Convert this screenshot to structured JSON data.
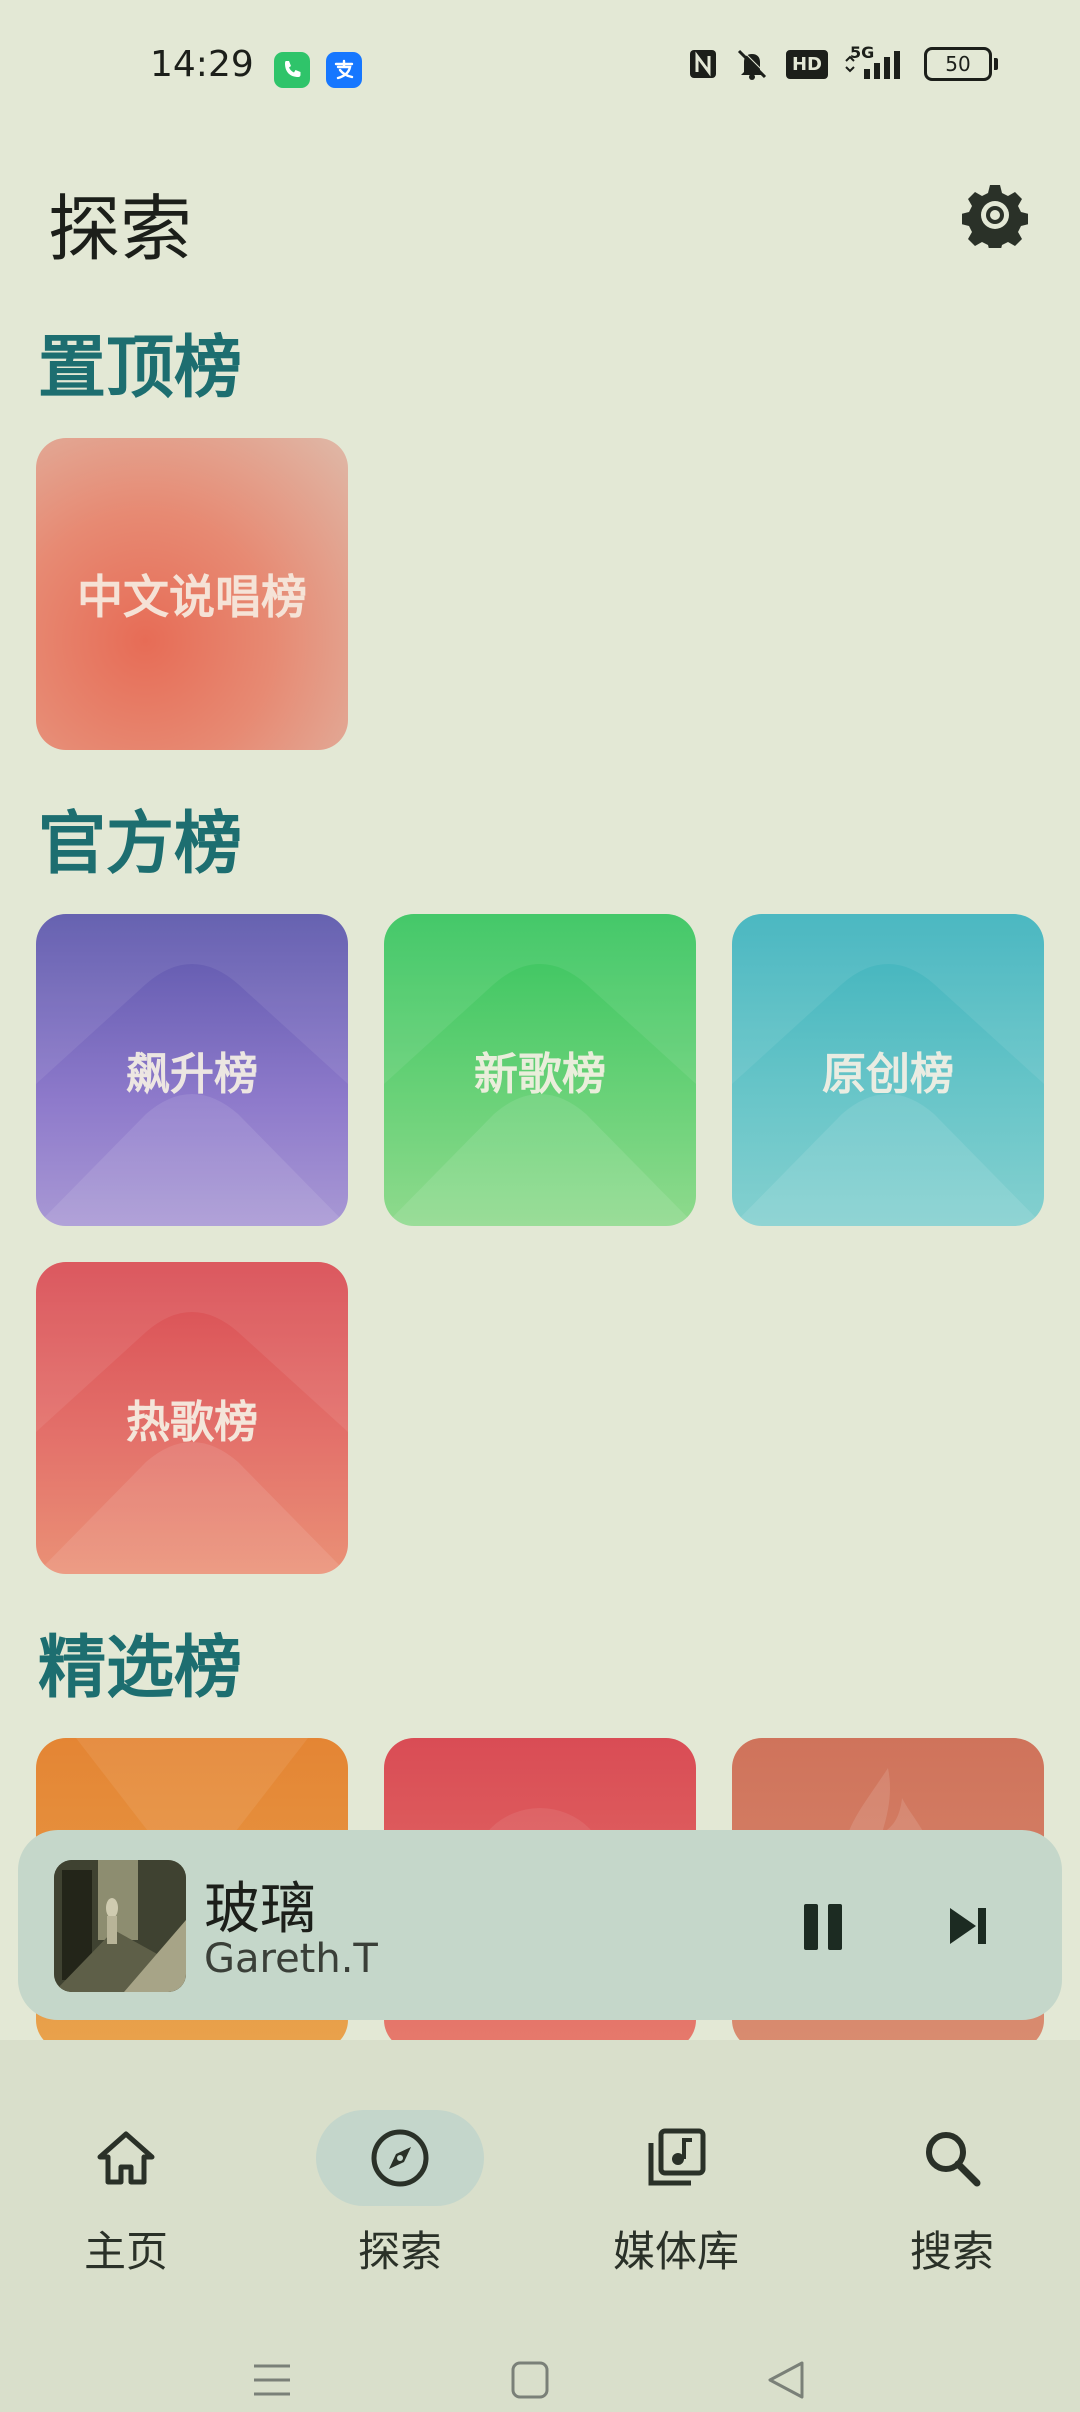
{
  "status_bar": {
    "time": "14:29",
    "battery": "50",
    "network": "5G",
    "hd": "HD"
  },
  "header": {
    "title": "探索"
  },
  "sections": {
    "pinned": {
      "title": "置顶榜",
      "tiles": [
        {
          "label": "中文说唱榜"
        }
      ]
    },
    "official": {
      "title": "官方榜",
      "tiles": [
        {
          "label": "飙升榜"
        },
        {
          "label": "新歌榜"
        },
        {
          "label": "原创榜"
        },
        {
          "label": "热歌榜"
        }
      ]
    },
    "featured": {
      "title": "精选榜"
    }
  },
  "player": {
    "title": "玻璃",
    "artist": "Gareth.T"
  },
  "nav": {
    "items": [
      {
        "label": "主页"
      },
      {
        "label": "探索"
      },
      {
        "label": "媒体库"
      },
      {
        "label": "搜索"
      }
    ],
    "active": "探索"
  },
  "colors": {
    "background": "#e3e8d5",
    "section_title": "#1d6e70",
    "player_bg": "#c5d7ca",
    "nav_active_pill": "#c4d6cb"
  }
}
